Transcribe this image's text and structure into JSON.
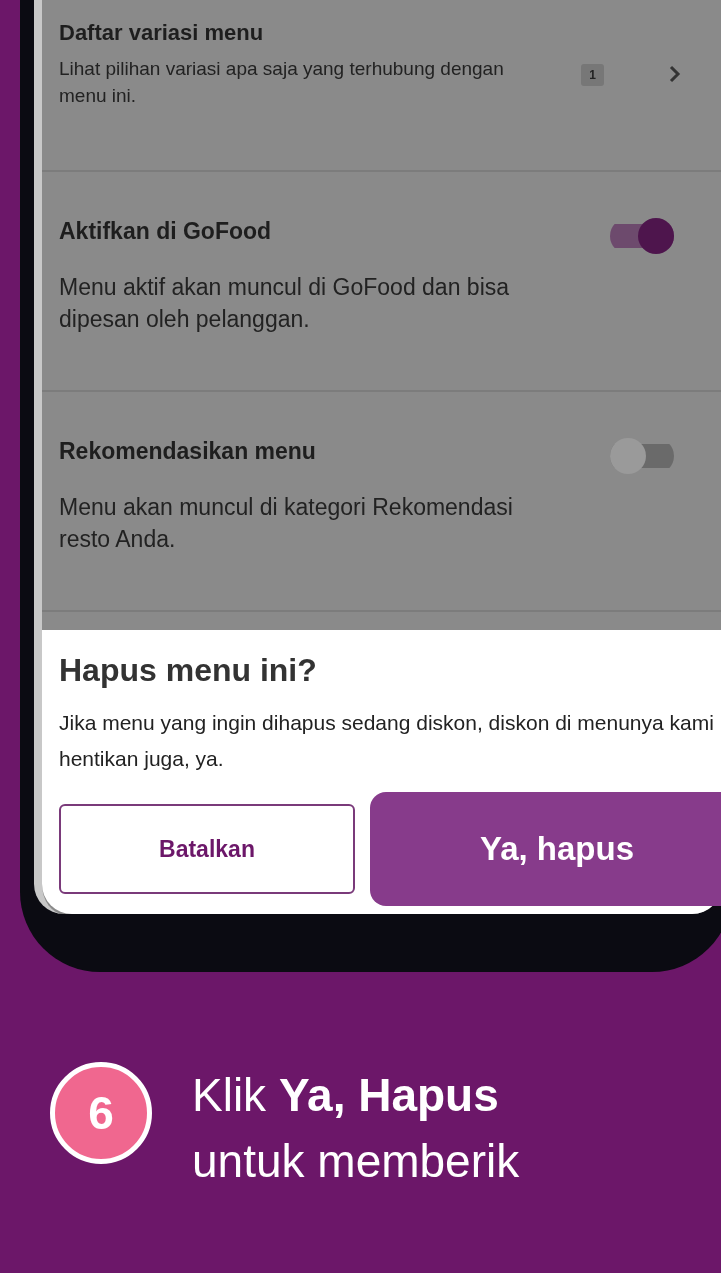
{
  "menu_items": [
    {
      "kind": "link",
      "title": "Daftar variasi menu",
      "description": "Lihat pilihan variasi apa saja yang terhubung dengan menu ini.",
      "badge": "1"
    },
    {
      "kind": "toggle",
      "title": "Aktifkan di GoFood",
      "description": "Menu aktif akan muncul di GoFood dan bisa dipesan oleh pelanggan.",
      "on": true
    },
    {
      "kind": "toggle",
      "title": "Rekomendasikan menu",
      "description": "Menu akan muncul di kategori Rekomendasi resto Anda.",
      "on": false
    }
  ],
  "dialog": {
    "title": "Hapus menu ini?",
    "message": "Jika menu yang ingin dihapus sedang diskon, diskon di menunya kami hentikan juga, ya.",
    "buttons": [
      {
        "kind": "secondary",
        "label": "Batalkan"
      },
      {
        "kind": "primary",
        "label": "Ya, hapus"
      }
    ]
  },
  "caption": {
    "step": "6",
    "line_1": "Klik **Ya, Hapus**",
    "line_2": "untuk memberik"
  }
}
